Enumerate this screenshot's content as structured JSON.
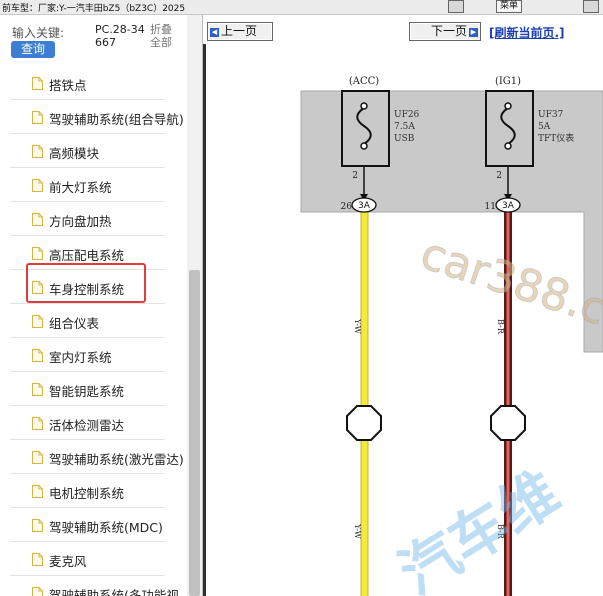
{
  "header": {
    "car_title": "前车型：厂家:Y-一汽丰田bZ5（bZ3C）2025",
    "top_button": "菜单"
  },
  "search": {
    "keyword_label": "输入关键:",
    "query_button": "查询",
    "pc_code": "PC.28-34667",
    "fold_button": "折叠全部"
  },
  "tree": {
    "items": [
      {
        "label": "搭铁点"
      },
      {
        "label": "驾驶辅助系统(组合导航)"
      },
      {
        "label": "高频模块"
      },
      {
        "label": "前大灯系统"
      },
      {
        "label": "方向盘加热"
      },
      {
        "label": "高压配电系统"
      },
      {
        "label": "车身控制系统"
      },
      {
        "label": "组合仪表"
      },
      {
        "label": "室内灯系统"
      },
      {
        "label": "智能钥匙系统"
      },
      {
        "label": "活体检测雷达"
      },
      {
        "label": "驾驶辅助系统(激光雷达)"
      },
      {
        "label": "电机控制系统"
      },
      {
        "label": "驾驶辅助系统(MDC)"
      },
      {
        "label": "麦克风"
      },
      {
        "label": "驾驶辅助系统(多功能视"
      }
    ],
    "selected_index": 6
  },
  "nav": {
    "prev": "上一页",
    "next": "下一页",
    "refresh": "[刷新当前页.]"
  },
  "diagram": {
    "fuse1": {
      "source": "(ACC)",
      "name": "UF26",
      "rating": "7.5A",
      "desc": "USB",
      "pin": "2",
      "conn_pin": "26",
      "conn": "3A",
      "wire": "Y-W"
    },
    "fuse2": {
      "source": "(IG1)",
      "name": "UF37",
      "rating": "5A",
      "desc": "TFT仪表",
      "pin": "2",
      "conn_pin": "11",
      "conn": "3A",
      "wire": "B-R"
    },
    "colors": {
      "wire1": "#f4ea3a",
      "wire2_base": "#5a1a14",
      "wire2_stripe": "#e06565",
      "panel": "#c9c9c9"
    },
    "watermark1": "car388.c",
    "watermark2": "汽车维"
  }
}
